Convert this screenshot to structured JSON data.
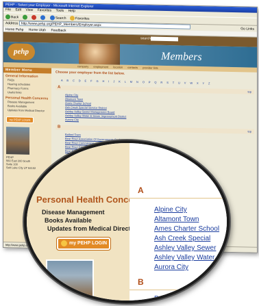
{
  "browser": {
    "title": "PEHP - Select your Employer - Microsoft Internet Explorer",
    "menu": [
      "File",
      "Edit",
      "View",
      "Favorites",
      "Tools",
      "Help"
    ],
    "toolbar": {
      "back": "Back",
      "search": "Search",
      "favorites": "Favorites"
    },
    "address_label": "Address",
    "address_value": "http://www.pehp.org/PEHP_Members/Employer.aspx",
    "go": "Go",
    "links_label": "Links",
    "favorites_bar": [
      "Home Pehp",
      "Home Utah",
      "Feedback"
    ],
    "status_text": "http://www.pehp.org/..."
  },
  "site": {
    "logo": "pehp",
    "search_label": "search",
    "banner_title": "Members",
    "nav": [
      "company",
      "employment",
      "location",
      "contacts",
      "provider lists"
    ],
    "sidebar": {
      "header": "Member Menu",
      "general_title": "General Information",
      "general_items": [
        "FAQs",
        "Hearing schedules",
        "Pharmacy Forms",
        "Useful links"
      ],
      "phc_title": "Personal Health Concerns",
      "phc_items": [
        "Disease Management",
        "Books Available",
        "Updates from Medical Director"
      ],
      "login": "my PEHP LOGIN",
      "address": [
        "PEHP",
        "560 East 200 South",
        "Suite 100",
        "Salt Lake City UT 84102"
      ]
    },
    "main": {
      "instruction": "Choose your employer from the list below.",
      "alphabet": "A B C D E F G H I J K L M N O P Q R S T U V W X Y Z",
      "top_link": "top",
      "section_a": "A",
      "section_b": "B",
      "employers_a": [
        "Alpine City",
        "Altamont Town",
        "Ames Charter School",
        "Ash Creek Special Service District",
        "Ashley Valley Sewer Management Board",
        "Ashley Valley Water & Sewer Improvement District",
        "Aurora City"
      ],
      "employers_b": [
        "Ballard Town",
        "Bear River Association Of Governments Cache",
        "Bear River Commission",
        "Bear River Education",
        "Bear River Health"
      ]
    }
  },
  "magnifier": {
    "title": "Personal Health Concerns",
    "items": [
      "Disease Management",
      "Books Available",
      "Updates from Medical Director"
    ],
    "login": "my PEHP LOGIN",
    "letter_a": "A",
    "letter_b": "B",
    "employers": [
      "Alpine City",
      "Altamont Town",
      "Ames Charter School",
      "Ash Creek Special",
      "Ashley Valley Sewer",
      "Ashley Valley Water",
      "Aurora City"
    ],
    "employer_b": "Ballard Town"
  }
}
